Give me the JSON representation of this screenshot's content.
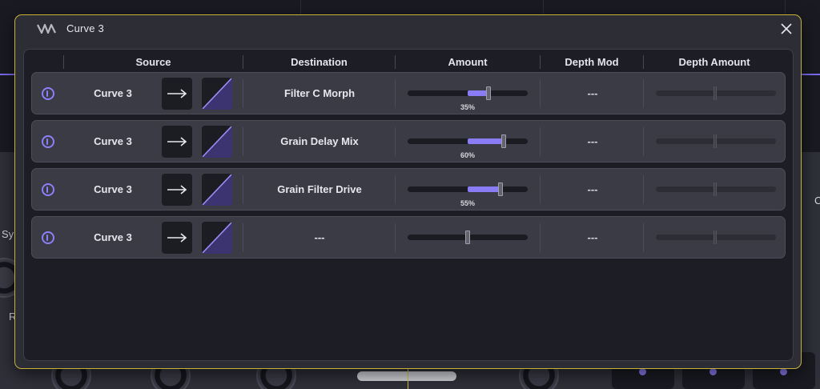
{
  "host": {
    "partial_label_sy": "Sy",
    "partial_label_r": "R",
    "partial_label_c": "C"
  },
  "modal": {
    "title": "Curve 3",
    "logo_icon": "waveform-logo-icon",
    "close_icon": "close-icon"
  },
  "columns": {
    "source": "Source",
    "destination": "Destination",
    "amount": "Amount",
    "depth_mod": "Depth Mod",
    "depth_amount": "Depth Amount"
  },
  "rows": [
    {
      "source": "Curve 3",
      "destination": "Filter C Morph",
      "amount": 0.35,
      "amount_label": "35%",
      "depth_mod": "---",
      "enabled": true
    },
    {
      "source": "Curve 3",
      "destination": "Grain Delay Mix",
      "amount": 0.6,
      "amount_label": "60%",
      "depth_mod": "---",
      "enabled": true
    },
    {
      "source": "Curve 3",
      "destination": "Grain Filter Drive",
      "amount": 0.55,
      "amount_label": "55%",
      "depth_mod": "---",
      "enabled": true
    },
    {
      "source": "Curve 3",
      "destination": "---",
      "amount": 0,
      "amount_label": "",
      "depth_mod": "---",
      "enabled": true
    }
  ],
  "colors": {
    "accent": "#8a7cf5",
    "modal_border": "#c8b23a"
  }
}
